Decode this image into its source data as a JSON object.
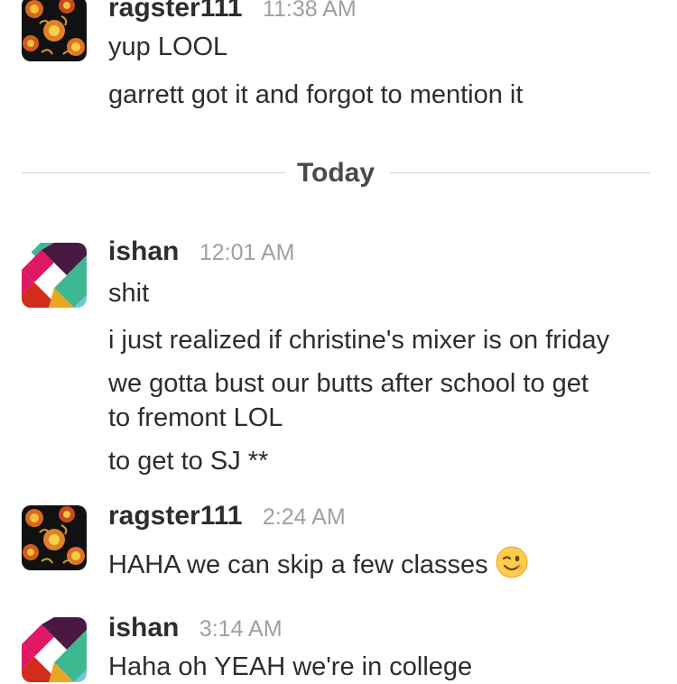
{
  "divider": {
    "label": "Today"
  },
  "messages": [
    {
      "username": "ragster111",
      "time": "11:38 AM",
      "avatar": "floral-avatar",
      "lines": [
        "yup LOOL",
        "garrett got it and forgot to mention it"
      ]
    },
    {
      "username": "ishan",
      "time": "12:01 AM",
      "avatar": "slack-logo-avatar",
      "lines": [
        "shit",
        "i just realized if christine's mixer is on friday",
        "we gotta bust our butts after school to get",
        "to fremont LOL",
        "to get to SJ **"
      ]
    },
    {
      "username": "ragster111",
      "time": "2:24 AM",
      "avatar": "floral-avatar",
      "lines": [
        "HAHA we can skip a few classes"
      ],
      "emoji": "winking-face-emoji"
    },
    {
      "username": "ishan",
      "time": "3:14 AM",
      "avatar": "slack-logo-avatar",
      "lines": [
        "Haha oh YEAH we're in college"
      ]
    }
  ]
}
